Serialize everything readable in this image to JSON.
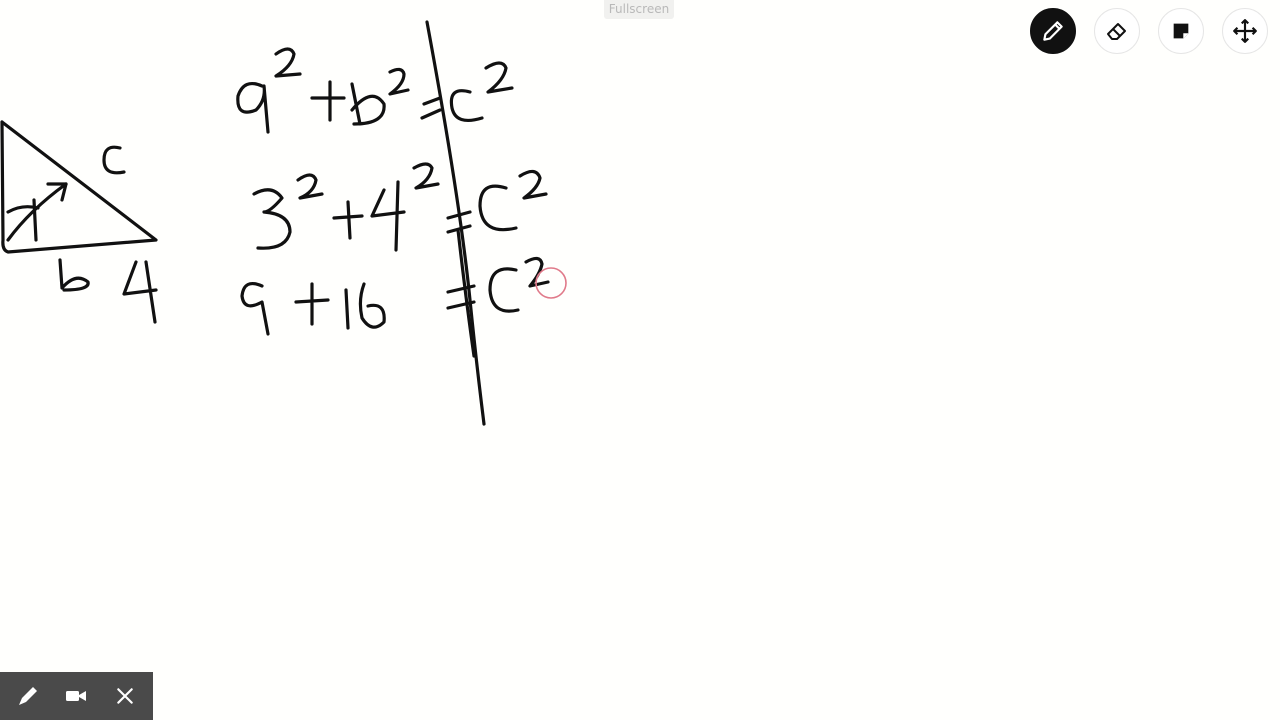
{
  "header": {
    "fullscreen_label": "Fullscreen"
  },
  "toolbar": {
    "tools": [
      {
        "name": "pen",
        "icon": "pencil-icon",
        "active": true
      },
      {
        "name": "eraser",
        "icon": "eraser-icon",
        "active": false
      },
      {
        "name": "sticky-note",
        "icon": "sticky-note-icon",
        "active": false
      },
      {
        "name": "move",
        "icon": "move-arrows-icon",
        "active": false
      }
    ]
  },
  "bottom_bar": {
    "buttons": [
      {
        "name": "draw",
        "icon": "pen-stroke-icon"
      },
      {
        "name": "camera",
        "icon": "video-camera-icon"
      },
      {
        "name": "close",
        "icon": "close-icon"
      }
    ]
  },
  "colors": {
    "ink": "#111111",
    "canvas_bg": "#fffffd",
    "cursor": "#e07a8a",
    "bar_bg": "#4a4a4a"
  }
}
